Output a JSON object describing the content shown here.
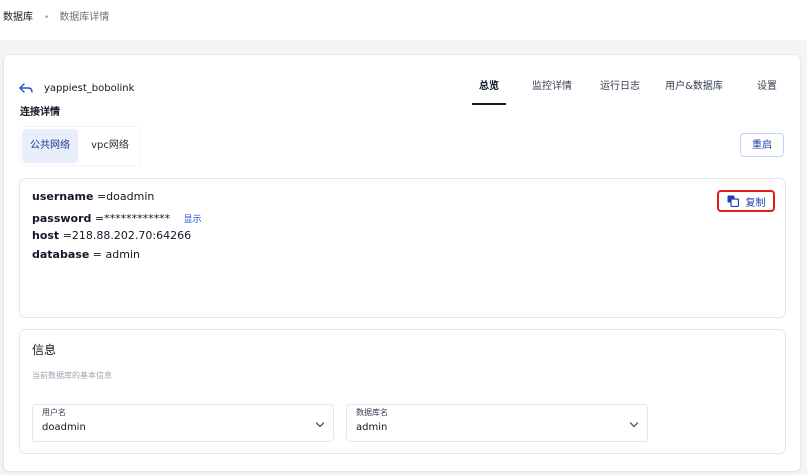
{
  "breadcrumb": {
    "root": "数据库",
    "separator": "•",
    "current": "数据库详情"
  },
  "header": {
    "back_icon": "arrow-back-icon",
    "db_name": "yappiest_bobolink"
  },
  "tabs": [
    {
      "label": "总览",
      "active": true
    },
    {
      "label": "监控详情",
      "active": false
    },
    {
      "label": "运行日志",
      "active": false
    },
    {
      "label": "用户&数据库",
      "active": false
    },
    {
      "label": "设置",
      "active": false
    }
  ],
  "connection": {
    "section_title": "连接详情",
    "network_tabs": [
      {
        "label": "公共网络",
        "active": true
      },
      {
        "label": "vpc网络",
        "active": false
      }
    ],
    "restart_label": "重启",
    "username_key": "username",
    "username_value": "=doadmin",
    "password_key": "password",
    "password_value": "=************",
    "show_label": "显示",
    "host_key": "host",
    "host_value": "=218.88.202.70:64266",
    "database_key": "database",
    "database_value": "= admin",
    "copy_label": "复制",
    "copy_icon": "copy-icon"
  },
  "info": {
    "title": "信息",
    "subtitle": "当前数据库的基本信息",
    "user_field": {
      "label": "用户名",
      "value": "doadmin"
    },
    "db_field": {
      "label": "数据库名",
      "value": "admin"
    }
  },
  "colors": {
    "accent": "#1e40af",
    "highlight_border": "#e11d1d",
    "active_tab_bg": "#e8eefc"
  }
}
